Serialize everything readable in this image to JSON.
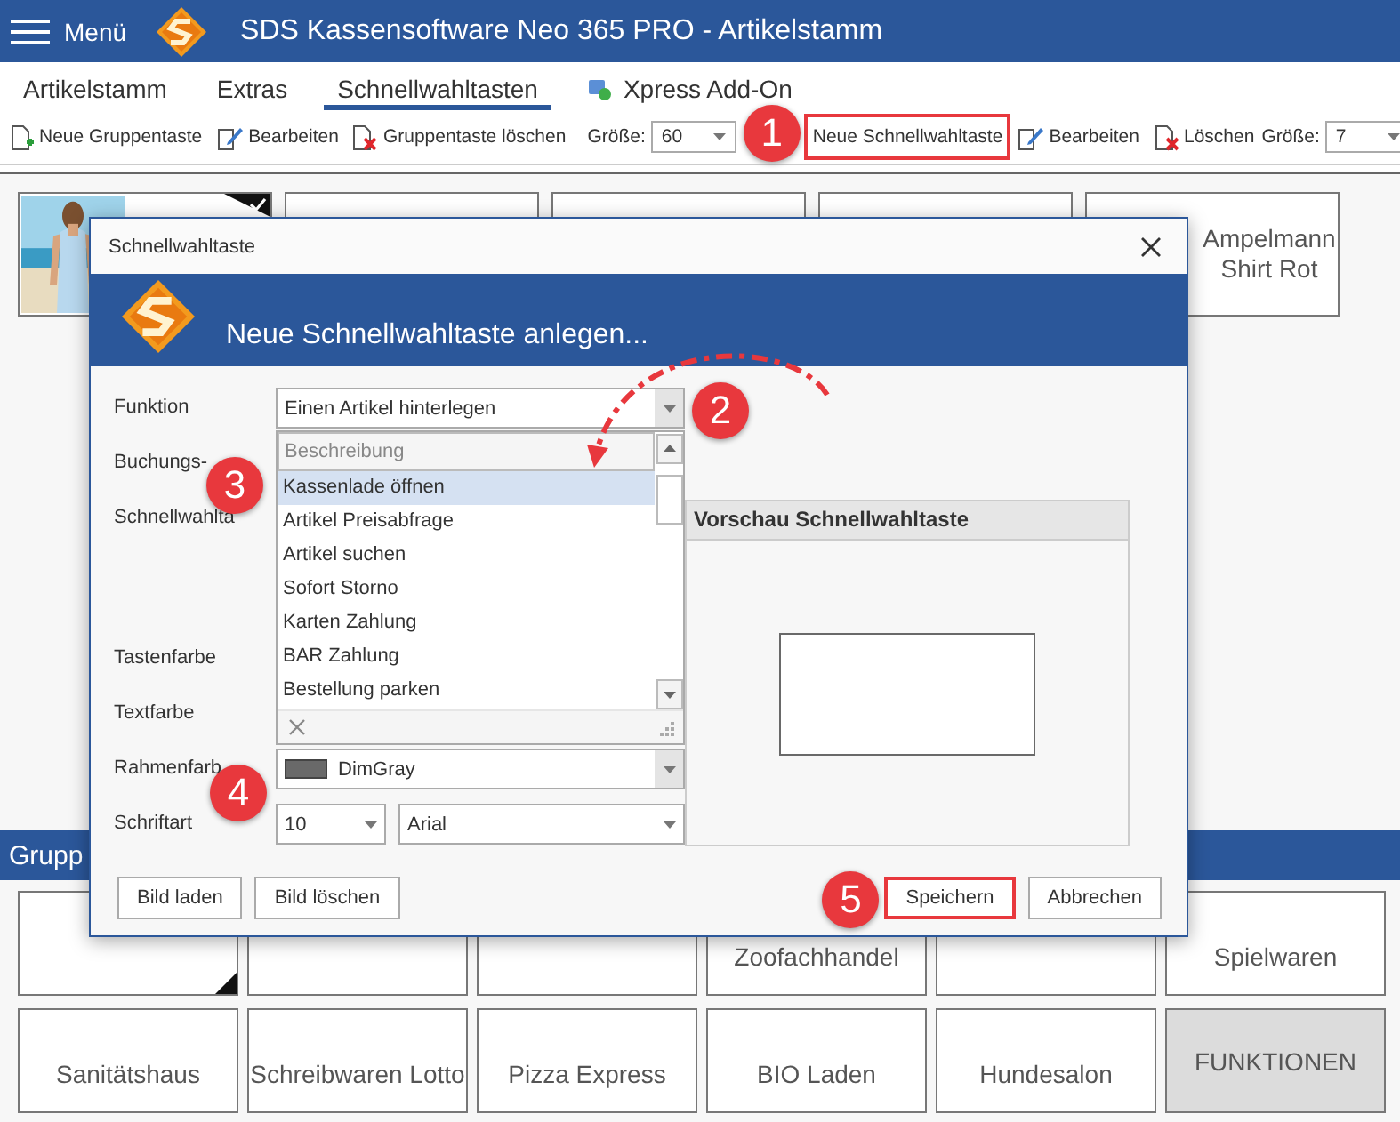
{
  "window": {
    "menu": "Menü",
    "title": "SDS Kassensoftware Neo 365 PRO - Artikelstamm"
  },
  "tabs": [
    {
      "label": "Artikelstamm",
      "selected": false,
      "kind": "plain"
    },
    {
      "label": "Extras",
      "selected": false,
      "kind": "plain"
    },
    {
      "label": "Schnellwahltasten",
      "selected": true,
      "kind": "plain"
    },
    {
      "label": "Xpress Add-On",
      "selected": false,
      "kind": "addon"
    }
  ],
  "toolbar": [
    {
      "kind": "new",
      "label": "Neue Gruppentaste"
    },
    {
      "kind": "edit",
      "label": "Bearbeiten"
    },
    {
      "kind": "delete",
      "label": "Gruppentaste löschen"
    },
    {
      "kind": "separator"
    },
    {
      "kind": "size",
      "label": "Größe:",
      "value": "60"
    },
    {
      "kind": "plain",
      "label": "Neue Schnellwahltaste",
      "highlighted": true,
      "callout": "1"
    },
    {
      "kind": "edit",
      "label": "Bearbeiten"
    },
    {
      "kind": "delete",
      "label": "Löschen"
    },
    {
      "kind": "size",
      "label": "Größe:",
      "value": "7"
    }
  ],
  "tiles": [
    {
      "kind": "picture",
      "selected": true
    },
    {
      "kind": "blank",
      "selected": false
    },
    {
      "kind": "blank",
      "selected": false
    },
    {
      "kind": "blank",
      "selected": false
    },
    {
      "kind": "text",
      "label": "Ampelmann Shirt Rot",
      "selected": false
    }
  ],
  "groups": {
    "title": "Grupp",
    "tiles": [
      {
        "kind": "group",
        "selected": true
      },
      {
        "kind": "group",
        "selected": false
      },
      {
        "kind": "group",
        "selected": false
      },
      {
        "kind": "group",
        "label": "Zoofachhandel",
        "selected": false
      },
      {
        "kind": "group",
        "selected": false
      },
      {
        "kind": "group",
        "label": "Spielwaren",
        "selected": false
      },
      {
        "kind": "group",
        "label": "Sanitätshaus",
        "selected": false
      },
      {
        "kind": "group",
        "label": "Schreibwaren Lotto",
        "selected": false
      },
      {
        "kind": "group",
        "label": "Pizza Express",
        "selected": false
      },
      {
        "kind": "group",
        "label": "BIO Laden",
        "selected": false
      },
      {
        "kind": "group",
        "label": "Hundesalon",
        "selected": false
      },
      {
        "kind": "function",
        "label": "FUNKTIONEN",
        "selected": false
      }
    ]
  },
  "dialog": {
    "title": "Schnellwahltaste",
    "heading": "Neue Schnellwahltaste anlegen...",
    "form": [
      {
        "kind": "combo",
        "label": "Funktion",
        "value": "Einen Artikel hinterlegen",
        "open": true,
        "callout": "2"
      },
      {
        "kind": "label",
        "label": "Buchungs-"
      },
      {
        "kind": "tall",
        "label": "Schnellwahlta"
      },
      {
        "kind": "label",
        "label": "Tastenfarbe"
      },
      {
        "kind": "label",
        "label": "Textfarbe"
      },
      {
        "kind": "color",
        "label": "Rahmenfarb",
        "value": "DimGray",
        "color": "#696969",
        "callout": "4"
      },
      {
        "kind": "font",
        "label": "Schriftart",
        "size": "10",
        "value": "Arial"
      }
    ],
    "dropdown": {
      "header": "Beschreibung",
      "items": [
        {
          "label": "Kassenlade öffnen",
          "selected": true,
          "callout": "3"
        },
        {
          "label": "Artikel Preisabfrage",
          "selected": false
        },
        {
          "label": "Artikel suchen",
          "selected": false
        },
        {
          "label": "Sofort Storno",
          "selected": false
        },
        {
          "label": "Karten Zahlung",
          "selected": false
        },
        {
          "label": "BAR Zahlung",
          "selected": false
        },
        {
          "label": "Bestellung parken",
          "selected": false
        }
      ]
    },
    "preview": {
      "title": "Vorschau Schnellwahltaste"
    },
    "buttons_left": [
      {
        "label": "Bild laden",
        "highlighted": false
      },
      {
        "label": "Bild löschen",
        "highlighted": false
      }
    ],
    "buttons_right": [
      {
        "label": "Speichern",
        "highlighted": true,
        "callout": "5"
      },
      {
        "label": "Abbrechen",
        "highlighted": false
      }
    ]
  }
}
